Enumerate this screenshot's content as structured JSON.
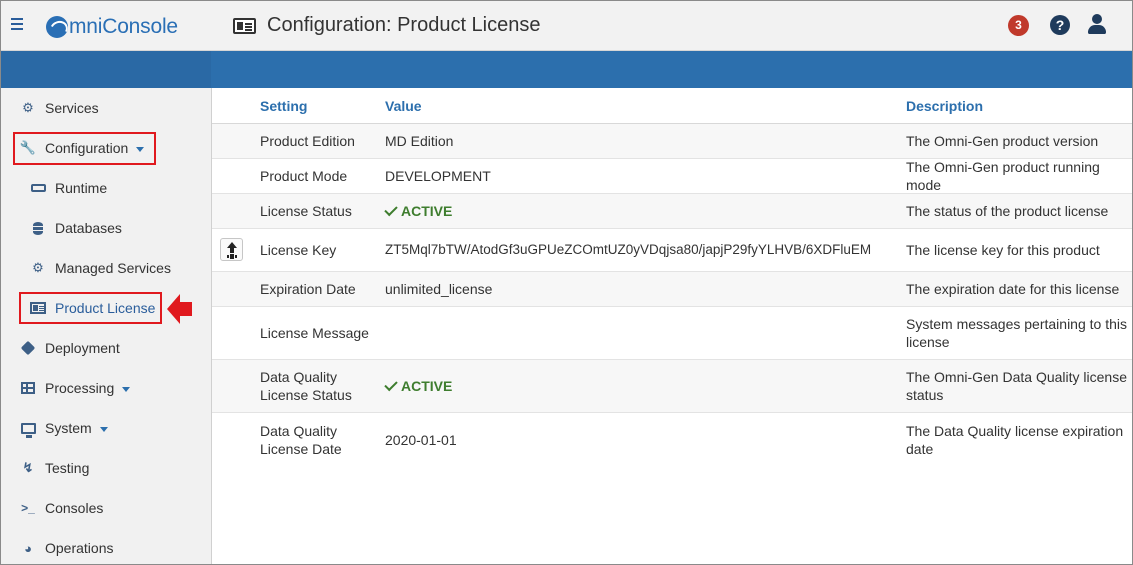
{
  "app": {
    "logo_text": "mniConsole",
    "page_title": "Configuration: Product License",
    "notification_count": "3",
    "help_glyph": "?"
  },
  "icons": {
    "menu": "hamburger-icon",
    "logo": "omni-logo-icon",
    "title": "id-card-icon",
    "help": "question-circle-icon",
    "user": "user-icon",
    "upload": "upload-icon",
    "check": "check-icon"
  },
  "colors": {
    "accent": "#2c6fad",
    "highlight": "#e0191e",
    "badge": "#c0392b",
    "active": "#3e7d2e"
  },
  "sidebar": {
    "items": [
      {
        "label": "Services",
        "icon": "cogs-icon"
      },
      {
        "label": "Configuration",
        "icon": "wrench-icon"
      },
      {
        "label": "Runtime",
        "icon": "hdd-icon"
      },
      {
        "label": "Databases",
        "icon": "database-icon"
      },
      {
        "label": "Managed Services",
        "icon": "cog-icon"
      },
      {
        "label": "Product License",
        "icon": "id-card-icon"
      },
      {
        "label": "Deployment",
        "icon": "cube-icon"
      },
      {
        "label": "Processing",
        "icon": "table-icon"
      },
      {
        "label": "System",
        "icon": "desktop-icon"
      },
      {
        "label": "Testing",
        "icon": "bolt-icon"
      },
      {
        "label": "Consoles",
        "icon": "terminal-icon"
      },
      {
        "label": "Operations",
        "icon": "dashboard-icon"
      }
    ]
  },
  "table": {
    "headers": {
      "setting": "Setting",
      "value": "Value",
      "description": "Description"
    },
    "rows": [
      {
        "setting": "Product Edition",
        "value": "MD Edition",
        "description": "The Omni-Gen product version"
      },
      {
        "setting": "Product Mode",
        "value": "DEVELOPMENT",
        "description": "The Omni-Gen product running mode"
      },
      {
        "setting": "License Status",
        "value": "ACTIVE",
        "description": "The status of the product license"
      },
      {
        "setting": "License Key",
        "value": "ZT5Mql7bTW/AtodGf3uGPUeZCOmtUZ0yVDqjsa80/japjP29fyYLHVB/6XDFluEM",
        "description": "The license key for this product"
      },
      {
        "setting": "Expiration Date",
        "value": "unlimited_license",
        "description": "The expiration date for this license"
      },
      {
        "setting": "License Message",
        "value": "",
        "description": "System messages pertaining to this license"
      },
      {
        "setting": "Data Quality License Status",
        "value": "ACTIVE",
        "description": "The Omni-Gen Data Quality license status"
      },
      {
        "setting": "Data Quality License Date",
        "value": "2020-01-01",
        "description": "The Data Quality license expiration date"
      }
    ]
  }
}
